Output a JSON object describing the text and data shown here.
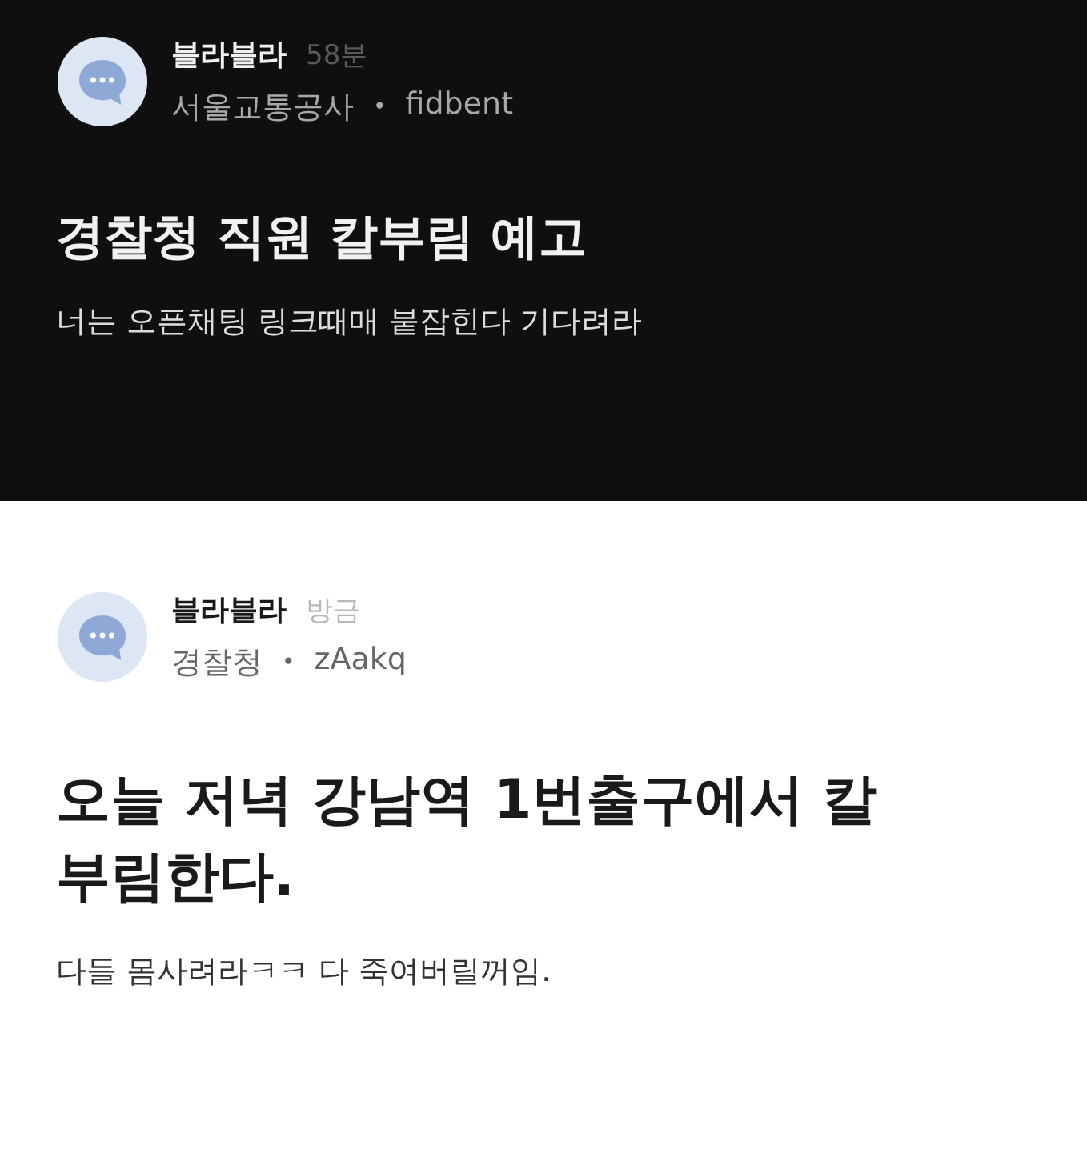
{
  "posts": [
    {
      "kind": "dark",
      "name": "블라블라",
      "time": "58분",
      "company": "서울교통공사",
      "separator": "•",
      "user": "fidbent",
      "title": "경찰청 직원 칼부림 예고",
      "body": "너는 오픈채팅 링크때매 붙잡힌다 기다려라"
    },
    {
      "kind": "light",
      "name": "블라블라",
      "time": "방금",
      "company": "경찰청",
      "separator": "•",
      "user": "zAakq",
      "title": "오늘 저녁 강남역 1번출구에서 칼부림한다.",
      "body": "다들 몸사려라ㅋㅋ 다 죽여버릴꺼임."
    }
  ]
}
